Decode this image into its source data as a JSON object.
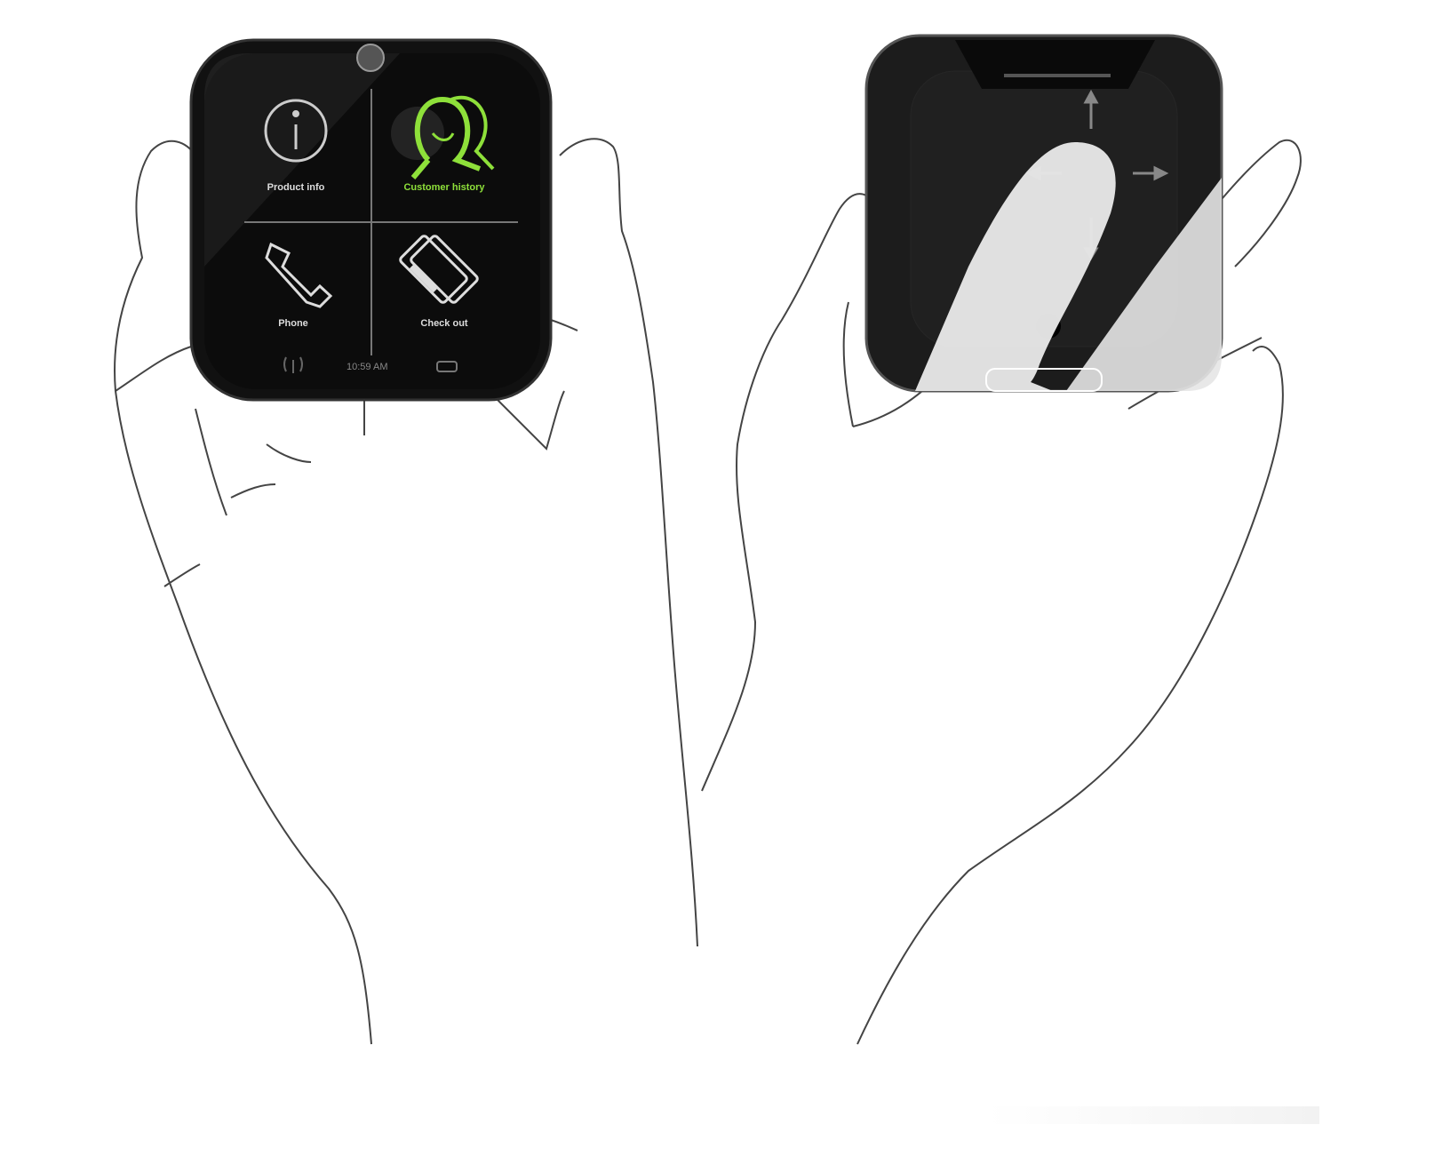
{
  "front_device": {
    "tiles": [
      {
        "label": "Product info",
        "icon": "info-icon",
        "active": false
      },
      {
        "label": "Customer history",
        "icon": "customer-history-icon",
        "active": true
      },
      {
        "label": "Phone",
        "icon": "phone-handset-icon",
        "active": false
      },
      {
        "label": "Check out",
        "icon": "credit-card-icon",
        "active": false
      }
    ],
    "status_bar": {
      "time": "10:59 AM",
      "signal_icon": "signal-icon",
      "battery_icon": "battery-icon"
    },
    "active_color": "#8ee03a",
    "screen_color": "#0c0c0c"
  },
  "back_device": {
    "gesture_arrows": [
      "up",
      "down",
      "left",
      "right"
    ],
    "body_color": "#1c1c1c"
  }
}
